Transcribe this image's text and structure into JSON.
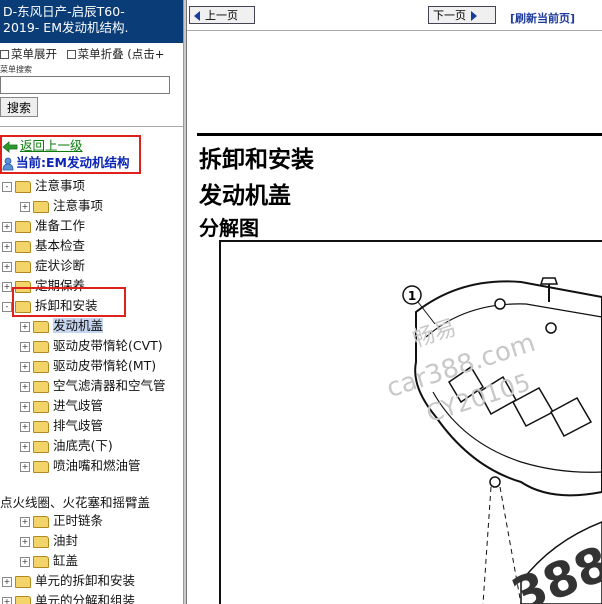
{
  "sidebar": {
    "title_line1": "D-东风日产-启辰T60-",
    "title_line2": "2019- EM发动机结构.",
    "menu_expand": "菜单展开",
    "menu_collapse": "菜单折叠 (点击+",
    "search_label": "菜单搜索",
    "search_value": "",
    "search_button": "搜索",
    "back_link": "返回上一级",
    "current": "当前:EM发动机结构",
    "tree": [
      {
        "label": "注意事项",
        "level": 0,
        "pm": "-"
      },
      {
        "label": "注意事项",
        "level": 1,
        "pm": "+"
      },
      {
        "label": "准备工作",
        "level": 0,
        "pm": "+"
      },
      {
        "label": "基本检查",
        "level": 0,
        "pm": "+"
      },
      {
        "label": "症状诊断",
        "level": 0,
        "pm": "+"
      },
      {
        "label": "定期保养",
        "level": 0,
        "pm": "+"
      },
      {
        "label": "拆卸和安装",
        "level": 0,
        "pm": "-"
      },
      {
        "label": "发动机盖",
        "level": 1,
        "pm": "+",
        "selected": true
      },
      {
        "label": "驱动皮带惰轮(CVT)",
        "level": 1,
        "pm": "+"
      },
      {
        "label": "驱动皮带惰轮(MT)",
        "level": 1,
        "pm": "+"
      },
      {
        "label": "空气滤清器和空气管",
        "level": 1,
        "pm": "+"
      },
      {
        "label": "进气歧管",
        "level": 1,
        "pm": "+"
      },
      {
        "label": "排气歧管",
        "level": 1,
        "pm": "+"
      },
      {
        "label": "油底壳(下)",
        "level": 1,
        "pm": "+"
      },
      {
        "label": "喷油嘴和燃油管",
        "level": 1,
        "pm": "+"
      },
      {
        "label": "点火线圈、火花塞和摇臂盖",
        "level": -1,
        "pm": ""
      },
      {
        "label": "正时链条",
        "level": 1,
        "pm": "+"
      },
      {
        "label": "油封",
        "level": 1,
        "pm": "+"
      },
      {
        "label": "缸盖",
        "level": 1,
        "pm": "+"
      },
      {
        "label": "单元的拆卸和安装",
        "level": 0,
        "pm": "+"
      },
      {
        "label": "单元的分解和组装",
        "level": 0,
        "pm": "+"
      }
    ]
  },
  "nav": {
    "prev": "上一页",
    "next": "下一页",
    "refresh": "[刷新当前页]"
  },
  "content": {
    "heading1": "拆卸和安装",
    "heading2": "发动机盖",
    "heading3": "分解图",
    "callout": "1",
    "watermark_lines": [
      "畅易",
      "car388.com",
      "CY20105"
    ],
    "watermark_bottom": "388"
  },
  "colors": {
    "title_bg": "#0a3d78",
    "highlight_box": "#e0211b",
    "back_link": "#0b7a0b",
    "current_link": "#0b24b5"
  }
}
